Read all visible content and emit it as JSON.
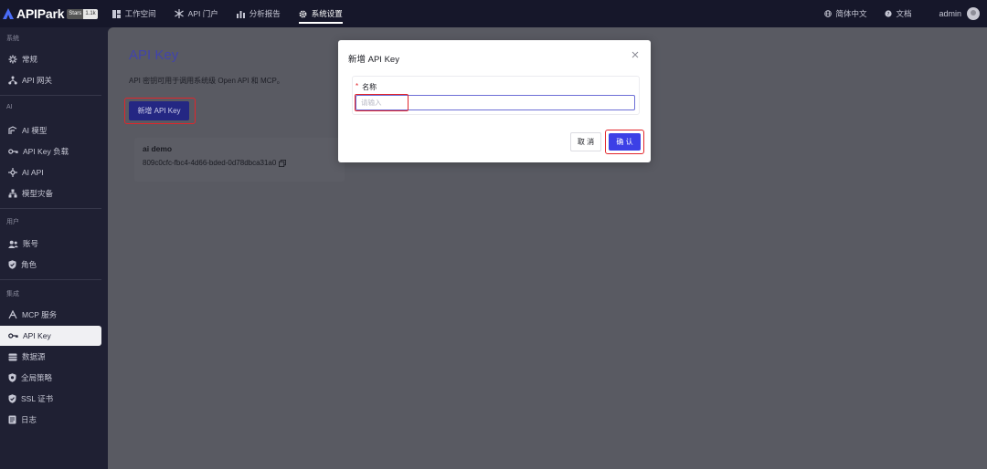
{
  "topbar": {
    "logo_text": "APIPark",
    "badge_left": "Stars",
    "badge_right": "1.1k",
    "nav": [
      {
        "label": "工作空间",
        "icon": "grid-icon"
      },
      {
        "label": "API 门户",
        "icon": "network-icon"
      },
      {
        "label": "分析报告",
        "icon": "chart-icon"
      },
      {
        "label": "系统设置",
        "icon": "gear-icon",
        "active": true
      }
    ],
    "language": "简体中文",
    "docs": "文档",
    "user": "admin"
  },
  "sidebar": {
    "sections": [
      {
        "label": "系统",
        "items": [
          {
            "label": "常规",
            "icon": "settings-icon"
          },
          {
            "label": "API 网关",
            "icon": "gateway-icon"
          }
        ]
      },
      {
        "label": "AI",
        "items": [
          {
            "label": "AI 模型",
            "icon": "ai-model-icon"
          },
          {
            "label": "API Key 负载",
            "icon": "key-icon"
          },
          {
            "label": "AI API",
            "icon": "api-icon"
          },
          {
            "label": "模型灾备",
            "icon": "failover-icon"
          }
        ]
      },
      {
        "label": "用户",
        "items": [
          {
            "label": "账号",
            "icon": "users-icon"
          },
          {
            "label": "角色",
            "icon": "shield-icon"
          }
        ]
      },
      {
        "label": "集成",
        "items": [
          {
            "label": "MCP 服务",
            "icon": "mcp-icon"
          },
          {
            "label": "API Key",
            "icon": "key-icon",
            "active": true
          },
          {
            "label": "数据源",
            "icon": "database-icon"
          },
          {
            "label": "全局策略",
            "icon": "policy-icon"
          },
          {
            "label": "SSL 证书",
            "icon": "ssl-icon"
          },
          {
            "label": "日志",
            "icon": "log-icon"
          }
        ]
      }
    ]
  },
  "main": {
    "title": "API Key",
    "description": "API 密钥可用于调用系统级 Open API 和 MCP。",
    "new_button": "新增 API Key",
    "card": {
      "name": "ai demo",
      "key": "809c0cfc-fbc4-4d66-bded-0d78dbca31a0"
    }
  },
  "modal": {
    "title": "新增 API Key",
    "field_label": "名称",
    "required_mark": "*",
    "placeholder": "请输入",
    "cancel": "取 消",
    "confirm": "确 认"
  },
  "colors": {
    "primary": "#3c40e6",
    "highlight": "#e2252b",
    "sidebar_bg": "#1f2033"
  }
}
